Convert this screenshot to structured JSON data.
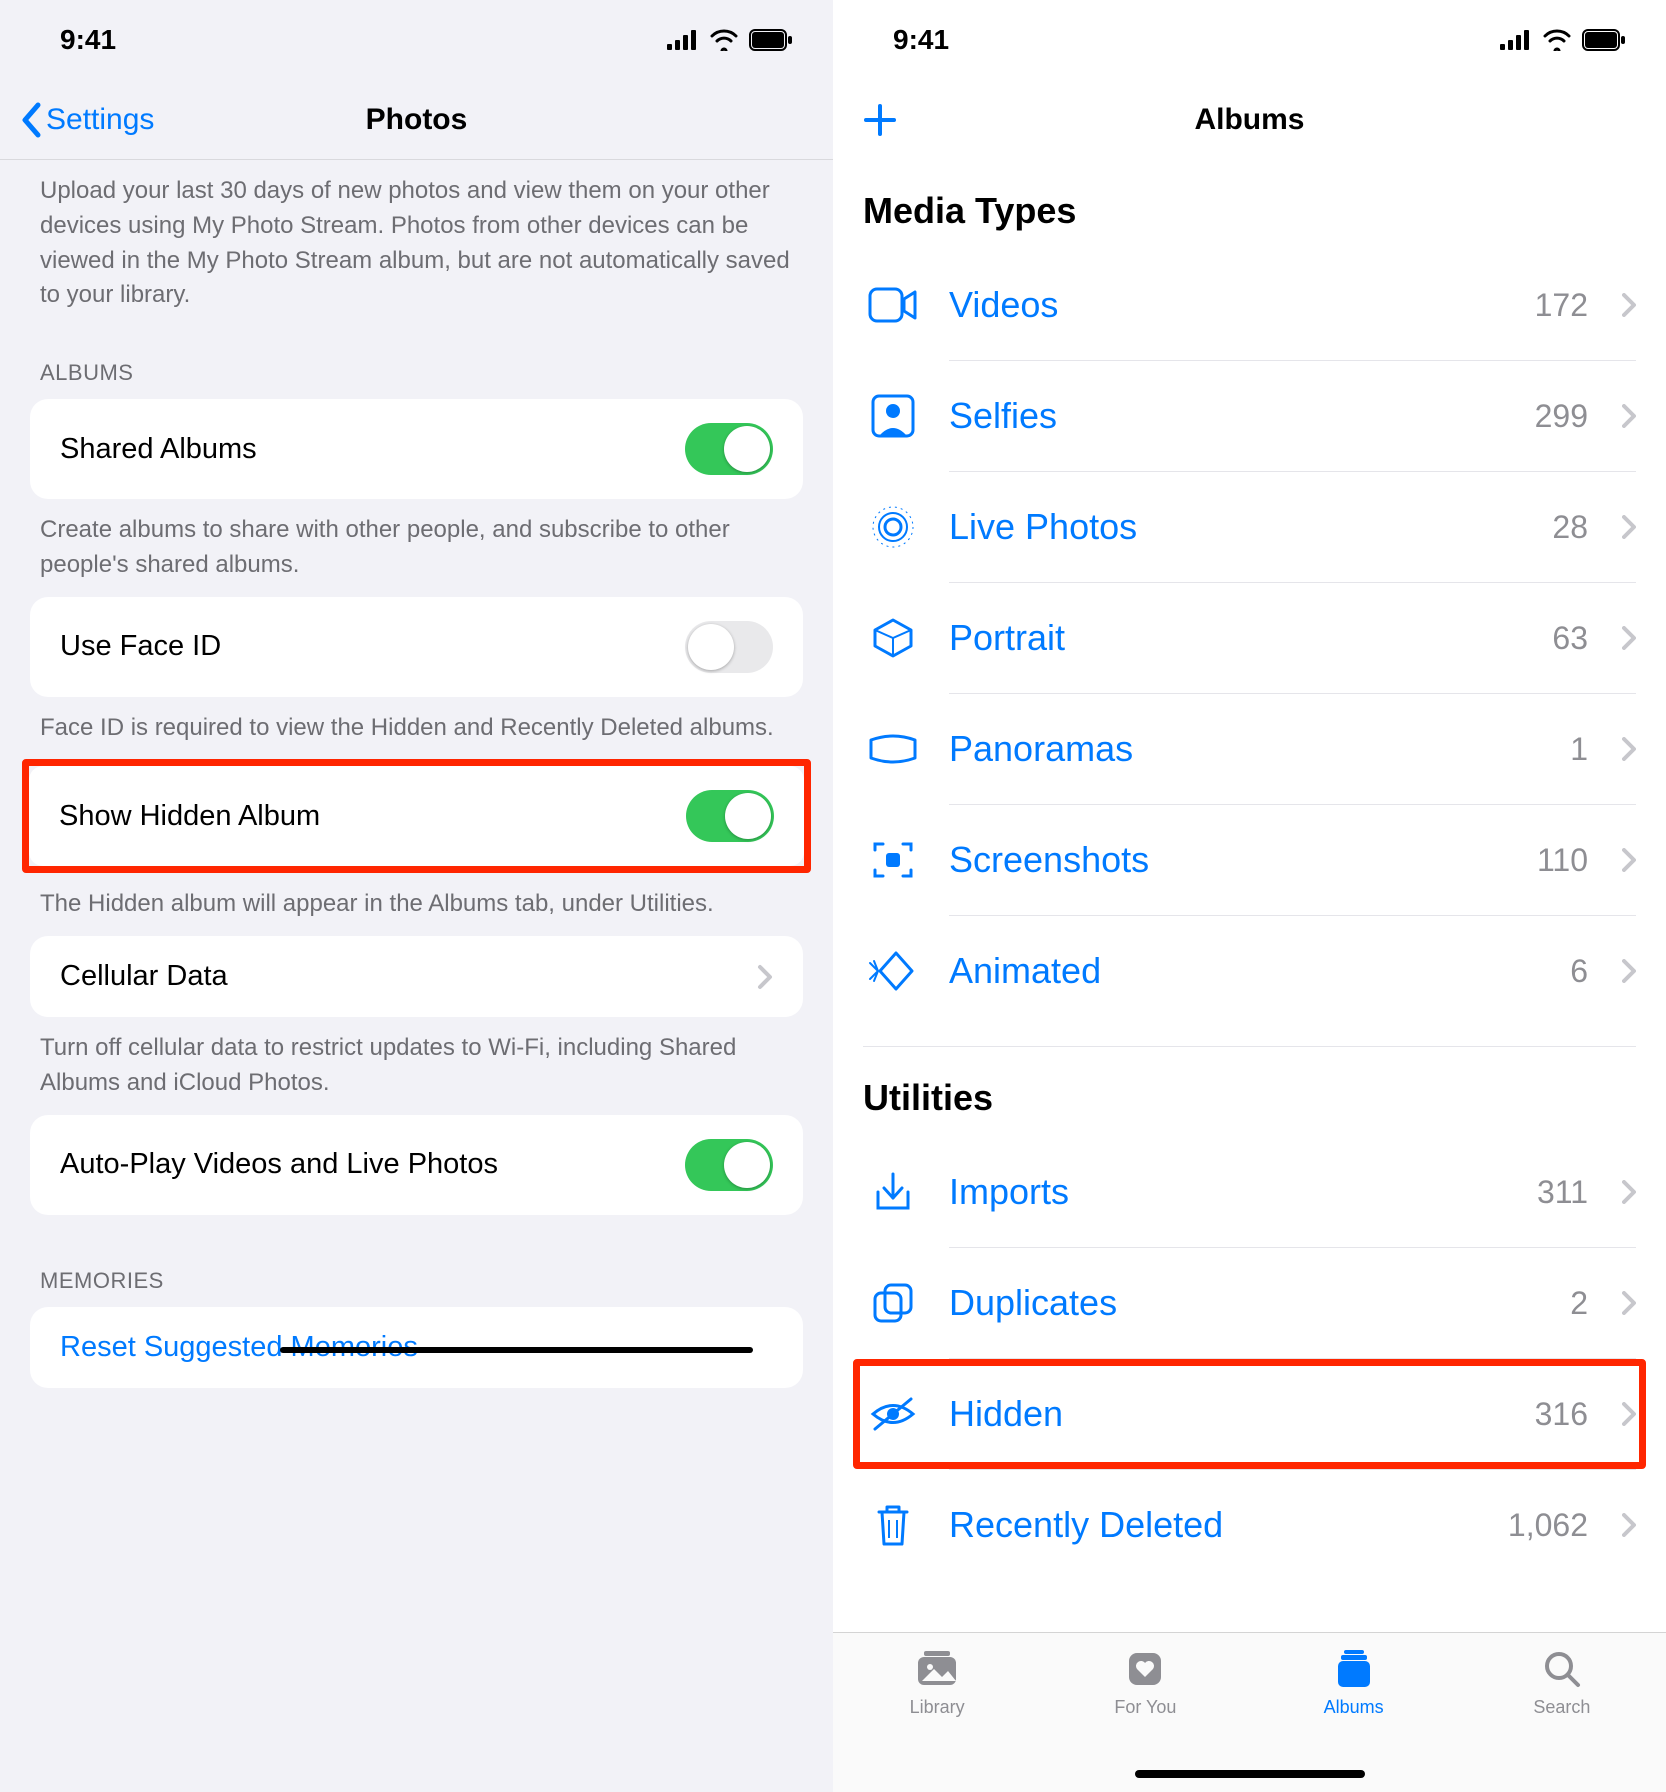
{
  "status": {
    "time": "9:41"
  },
  "left": {
    "back_label": "Settings",
    "title": "Photos",
    "photo_stream_footer": "Upload your last 30 days of new photos and view them on your other devices using My Photo Stream. Photos from other devices can be viewed in the My Photo Stream album, but are not automatically saved to your library.",
    "albums_header": "Albums",
    "shared_albums_label": "Shared Albums",
    "shared_albums_footer": "Create albums to share with other people, and subscribe to other people's shared albums.",
    "use_faceid_label": "Use Face ID",
    "use_faceid_footer": "Face ID is required to view the Hidden and Recently Deleted albums.",
    "show_hidden_label": "Show Hidden Album",
    "show_hidden_footer": "The Hidden album will appear in the Albums tab, under Utilities.",
    "cellular_label": "Cellular Data",
    "cellular_footer": "Turn off cellular data to restrict updates to Wi-Fi, including Shared Albums and iCloud Photos.",
    "autoplay_label": "Auto-Play Videos and Live Photos",
    "memories_header": "Memories",
    "reset_label": "Reset Suggested Memories"
  },
  "right": {
    "title": "Albums",
    "media_types_header": "Media Types",
    "utilities_header": "Utilities",
    "rows": {
      "videos": {
        "label": "Videos",
        "count": "172"
      },
      "selfies": {
        "label": "Selfies",
        "count": "299"
      },
      "live": {
        "label": "Live Photos",
        "count": "28"
      },
      "portrait": {
        "label": "Portrait",
        "count": "63"
      },
      "panoramas": {
        "label": "Panoramas",
        "count": "1"
      },
      "screenshots": {
        "label": "Screenshots",
        "count": "110"
      },
      "animated": {
        "label": "Animated",
        "count": "6"
      },
      "imports": {
        "label": "Imports",
        "count": "311"
      },
      "duplicates": {
        "label": "Duplicates",
        "count": "2"
      },
      "hidden": {
        "label": "Hidden",
        "count": "316"
      },
      "recently": {
        "label": "Recently Deleted",
        "count": "1,062"
      }
    },
    "tabs": {
      "library": "Library",
      "foryou": "For You",
      "albums": "Albums",
      "search": "Search"
    }
  }
}
